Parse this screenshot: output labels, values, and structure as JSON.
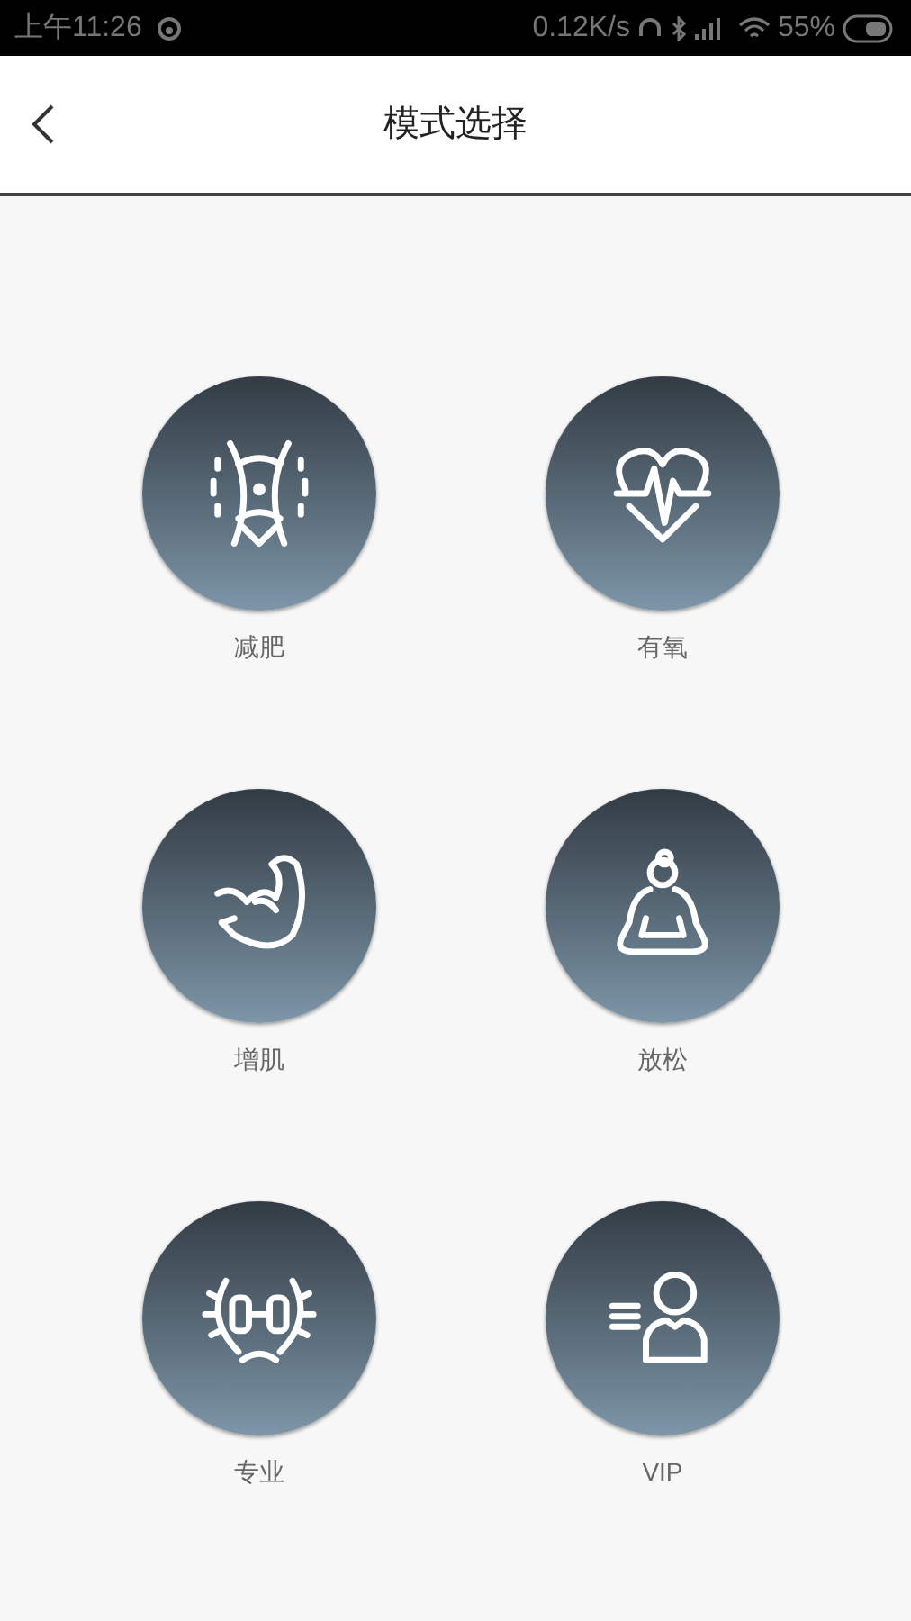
{
  "status_bar": {
    "time": "上午11:26",
    "speed": "0.12K/s",
    "battery": "55%"
  },
  "header": {
    "title": "模式选择"
  },
  "modes": [
    {
      "label": "减肥"
    },
    {
      "label": "有氧"
    },
    {
      "label": "增肌"
    },
    {
      "label": "放松"
    },
    {
      "label": "专业"
    },
    {
      "label": "VIP"
    }
  ]
}
